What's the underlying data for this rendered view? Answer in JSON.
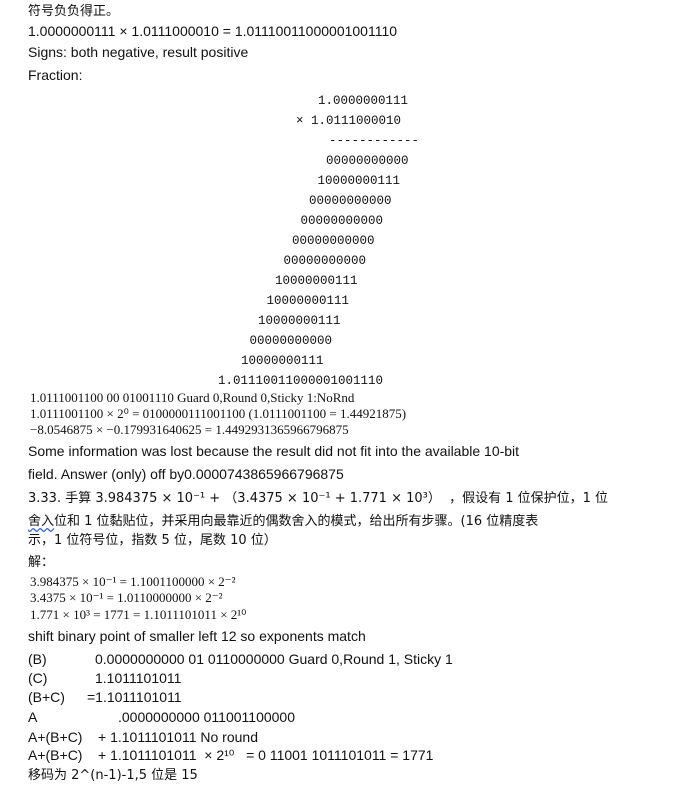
{
  "header": {
    "line1": "符号负负得正。",
    "line2": "1.0000000111 × 1.0111000010 = 1.01110011000001001110",
    "line3": "Signs: both negative, result positive",
    "line4": "Fraction:"
  },
  "multiplication": {
    "multiplicand": "1.0000000111",
    "multiplier": "× 1.0111000010",
    "separator": "------------",
    "partials": [
      "00000000000",
      "10000000111",
      "00000000000",
      "00000000000",
      "00000000000",
      "00000000000",
      "10000000111",
      "10000000111",
      "10000000111",
      "00000000000",
      "10000000111"
    ],
    "result": "1.01110011000001001110"
  },
  "rounding": {
    "line1": "1.0111001100 00 01001110 Guard 0,Round 0,Sticky 1:NoRnd",
    "line2": "1.0111001100 × 2⁰ = 0100000111001100 (1.0111001100 = 1.44921875)",
    "line3": "−8.0546875 × −0.179931640625 = 1.4492931365966796875",
    "line4": "Some information was lost because the result did not fit into the available 10-bit",
    "line5": "field. Answer (only) off by0.0000743865966796875"
  },
  "problem": {
    "line1": "3.33. 手算 3.984375 × 10⁻¹ + （3.4375 × 10⁻¹ + 1.771 × 10³）  ，假设有 1 位保护位，1 位",
    "line2": "舍入位和 1 位黏贴位，并采用向最靠近的偶数舍入的模式，给出所有步骤。(16 位精度表",
    "line3": "示，1 位符号位，指数 5 位，尾数 10 位）",
    "solution_label": "解：",
    "conv1": "3.984375 × 10⁻¹ = 1.1001100000 × 2⁻²",
    "conv2": "3.4375 × 10⁻¹ = 1.0110000000 × 2⁻²",
    "conv3": "1.771 × 10³ = 1771 = 1.1011101011 × 2¹⁰",
    "shift": "shift binary point of smaller left 12 so exponents match"
  },
  "steps": {
    "b_label": "(B)",
    "b_value": "0.0000000000 01 0110000000 Guard 0,Round 1, Sticky 1",
    "c_label": "(C)",
    "c_value": "1.1011101011",
    "bc_label": "(B+C)",
    "bc_value": "=1.1011101011",
    "a_label": "A",
    "a_value": ".0000000000 011001100000",
    "sum1": "A+(B+C)    + 1.1011101011 No round",
    "sum2": "A+(B+C)    + 1.1011101011  × 2¹⁰   = 0 11001 1011101011 = 1771",
    "bias": "移码为 2^(n-1)-1,5 位是 15"
  }
}
